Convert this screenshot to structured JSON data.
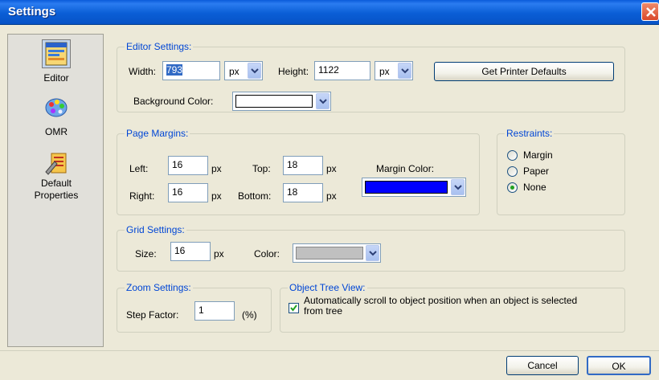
{
  "window": {
    "title": "Settings"
  },
  "sidebar": {
    "items": [
      {
        "label": "Editor",
        "icon": "editor-icon",
        "selected": true
      },
      {
        "label": "OMR",
        "icon": "palette-icon",
        "selected": false
      },
      {
        "label": "Default Properties",
        "icon": "properties-icon",
        "selected": false
      }
    ]
  },
  "editor_settings": {
    "legend": "Editor Settings:",
    "width_label": "Width:",
    "width_value": "793",
    "width_unit": "px",
    "height_label": "Height:",
    "height_value": "1122",
    "height_unit": "px",
    "printer_defaults_label": "Get Printer Defaults",
    "background_color_label": "Background Color:",
    "background_color": "#ffffff"
  },
  "page_margins": {
    "legend": "Page Margins:",
    "left_label": "Left:",
    "left_value": "16",
    "top_label": "Top:",
    "top_value": "18",
    "right_label": "Right:",
    "right_value": "16",
    "bottom_label": "Bottom:",
    "bottom_value": "18",
    "unit": "px",
    "margin_color_label": "Margin Color:",
    "margin_color": "#0000ff"
  },
  "restraints": {
    "legend": "Restraints:",
    "options": [
      {
        "label": "Margin",
        "checked": false
      },
      {
        "label": "Paper",
        "checked": false
      },
      {
        "label": "None",
        "checked": true
      }
    ]
  },
  "grid_settings": {
    "legend": "Grid Settings:",
    "size_label": "Size:",
    "size_value": "16",
    "unit": "px",
    "color_label": "Color:",
    "color": "#c0c0c0"
  },
  "zoom_settings": {
    "legend": "Zoom Settings:",
    "step_factor_label": "Step Factor:",
    "step_factor_value": "1",
    "unit": "(%)"
  },
  "object_tree": {
    "legend": "Object Tree View:",
    "autoscroll_label_line1": "Automatically scroll to object position when an object is selected",
    "autoscroll_label_line2": "from tree",
    "autoscroll_checked": true
  },
  "footer": {
    "cancel_label": "Cancel",
    "ok_label": "OK"
  }
}
